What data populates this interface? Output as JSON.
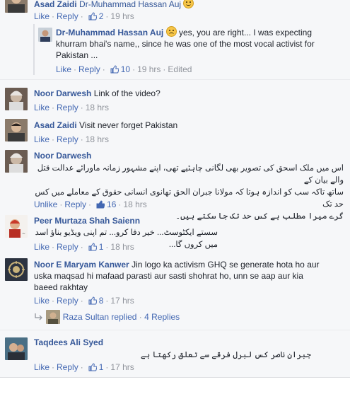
{
  "comments": [
    {
      "name": "Asad Zaidi",
      "text": "Dr-Muhammad Hassan Auj",
      "like": "Like",
      "reply": "Reply",
      "likes": "2",
      "time": "19 hrs"
    },
    {
      "name": "Dr-Muhammad Hassan Auj",
      "text_line1": "yes, you are right... I was expecting",
      "text_line2": "khurram bhai's name,, since he was one of the most vocal activist for",
      "text_line3": "Pakistan ...",
      "like": "Like",
      "reply": "Reply",
      "likes": "10",
      "time": "19 hrs",
      "edited": "Edited"
    },
    {
      "name": "Noor Darwesh",
      "text": "Link of the video?",
      "like": "Like",
      "reply": "Reply",
      "time": "18 hrs"
    },
    {
      "name": "Asad Zaidi",
      "text": "Visit never forget Pakistan",
      "like": "Like",
      "reply": "Reply",
      "time": "18 hrs"
    },
    {
      "name": "Noor Darwesh",
      "urdu_line1": "اس میں ملک اسحق کی تصویر بھی لگانی چاہئیے تھی، اپنے مشہور زمانہ ماورائے عدالت قتل والے بیان کے",
      "urdu_line2": "ساتھ تاکہ سب کو اندازہ ہوتا کہ مولانا جبران الحق تھانوی انسانی حقوق کے معاملے میں کس حد تک",
      "urdu_line3": "گرے میرا مطلب ہے کس حد تک جا سکتے ہیں۔",
      "like": "Unlike",
      "reply": "Reply",
      "likes": "16",
      "time": "18 hrs"
    },
    {
      "name": "Peer Murtaza Shah Saienn",
      "urdu_line1": "سستے ایکٹوسٹ... خیر دفا کرو... تم اپنی ویڈیو بناؤ اسد میں کروں گا...",
      "like": "Like",
      "reply": "Reply",
      "likes": "1",
      "time": "18 hrs"
    },
    {
      "name": "Noor E Maryam Kanwer",
      "text_line1": "Jin logo ka activism GHQ se generate hota ho aur",
      "text_line2": "uska maqsad hi mafaad parasti aur sasti shohrat ho, unn se aap aur kia",
      "text_line3": "baeed rakhtay",
      "like": "Like",
      "reply": "Reply",
      "likes": "8",
      "time": "17 hrs",
      "replies_name": "Raza Sultan",
      "replies_text": "replied",
      "replies_count": "4 Replies"
    },
    {
      "name": "Taqdees Ali Syed",
      "urdu_line1": "جبران ناصر کس لبرل فرقے سے تعلق رکھتا ہے",
      "like": "Like",
      "reply": "Reply",
      "likes": "1",
      "time": "17 hrs"
    }
  ],
  "colors": {
    "link": "#365899",
    "action": "#4267b2",
    "meta": "#90949c",
    "text": "#1d2129"
  },
  "icons": [
    "thumbs-up-icon",
    "smile-emoji-icon",
    "sad-emoji-icon"
  ]
}
